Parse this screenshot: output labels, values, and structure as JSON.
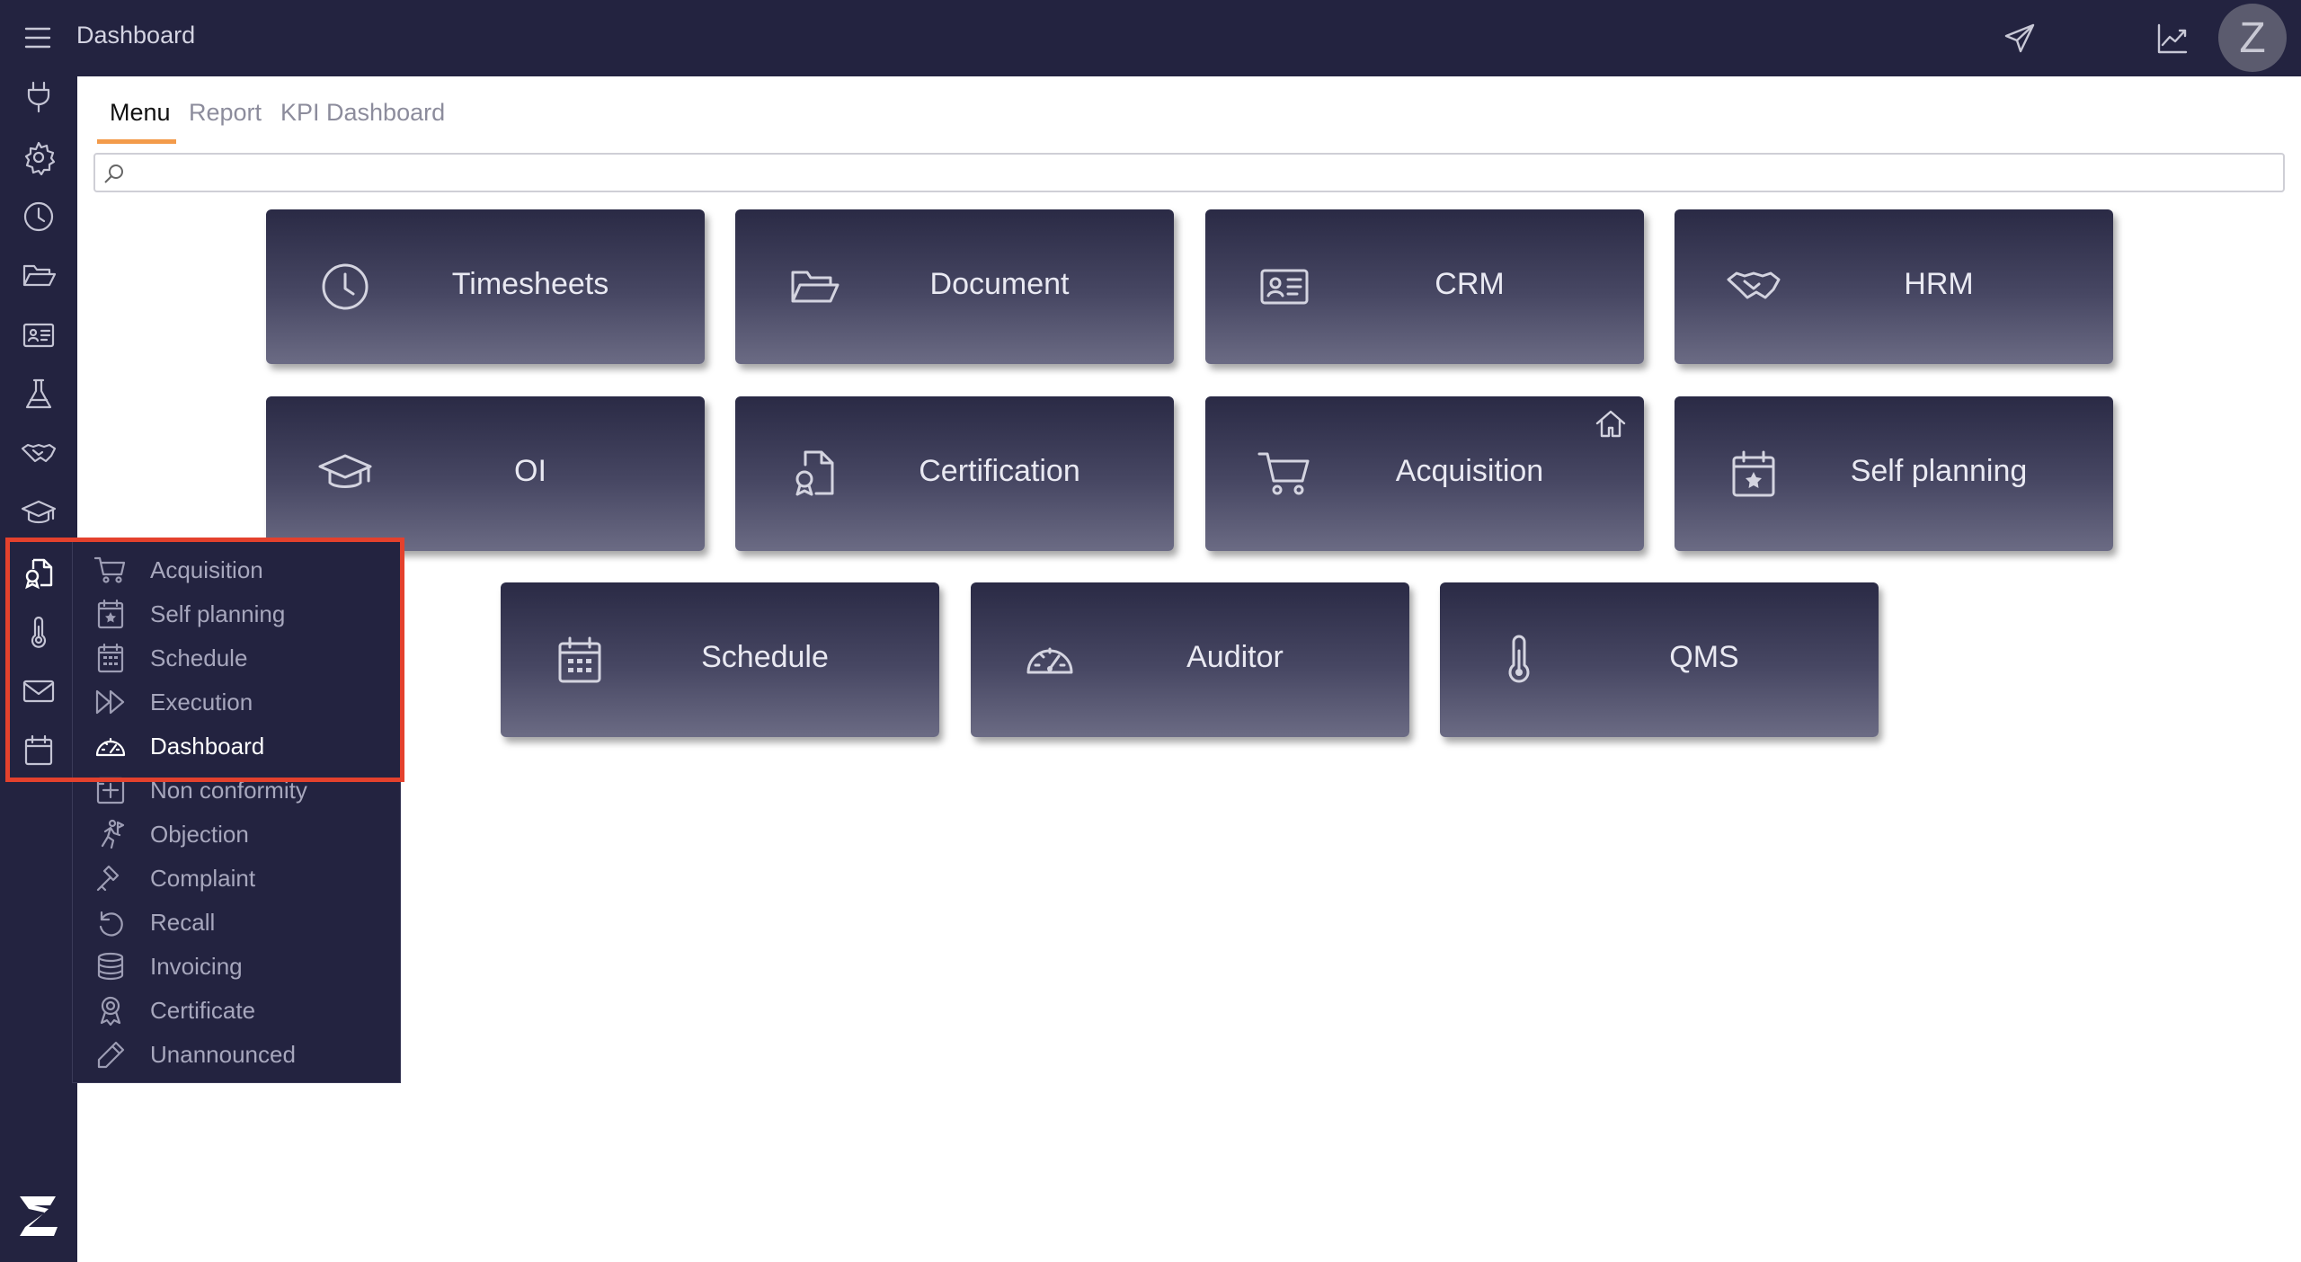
{
  "header": {
    "title": "Dashboard",
    "avatar_letter": "Z"
  },
  "tabs": [
    {
      "label": "Menu",
      "active": true
    },
    {
      "label": "Report",
      "active": false
    },
    {
      "label": "KPI Dashboard",
      "active": false
    }
  ],
  "search": {
    "value": "",
    "placeholder": ""
  },
  "tiles": [
    {
      "label": "Timesheets",
      "icon": "clock-icon"
    },
    {
      "label": "Document",
      "icon": "folder-open-icon"
    },
    {
      "label": "CRM",
      "icon": "id-card-icon"
    },
    {
      "label": "HRM",
      "icon": "handshake-icon"
    },
    {
      "label": "OI",
      "icon": "graduation-cap-icon"
    },
    {
      "label": "Certification",
      "icon": "certificate-file-icon"
    },
    {
      "label": "Acquisition",
      "icon": "shopping-cart-icon",
      "home_badge": "home-icon"
    },
    {
      "label": "Self planning",
      "icon": "calendar-star-icon"
    },
    {
      "label": "Schedule",
      "icon": "calendar-grid-icon"
    },
    {
      "label": "Auditor",
      "icon": "gauge-icon"
    },
    {
      "label": "QMS",
      "icon": "thermometer-icon"
    }
  ],
  "submenu": {
    "items": [
      {
        "label": "Acquisition",
        "icon": "shopping-cart-icon"
      },
      {
        "label": "Self planning",
        "icon": "calendar-star-icon"
      },
      {
        "label": "Schedule",
        "icon": "calendar-grid-icon"
      },
      {
        "label": "Execution",
        "icon": "fast-forward-icon"
      },
      {
        "label": "Dashboard",
        "icon": "gauge-icon",
        "active": true
      },
      {
        "label": "Non conformity",
        "icon": "plus-square-icon"
      },
      {
        "label": "Objection",
        "icon": "running-person-icon"
      },
      {
        "label": "Complaint",
        "icon": "gavel-icon"
      },
      {
        "label": "Recall",
        "icon": "undo-icon"
      },
      {
        "label": "Invoicing",
        "icon": "coins-icon"
      },
      {
        "label": "Certificate",
        "icon": "award-icon"
      },
      {
        "label": "Unannounced",
        "icon": "pen-icon"
      }
    ]
  },
  "colors": {
    "topbar": "#232340",
    "accent": "#f39b4b",
    "highlight": "#e4412d",
    "tile_bottom": "#6b6b84"
  }
}
